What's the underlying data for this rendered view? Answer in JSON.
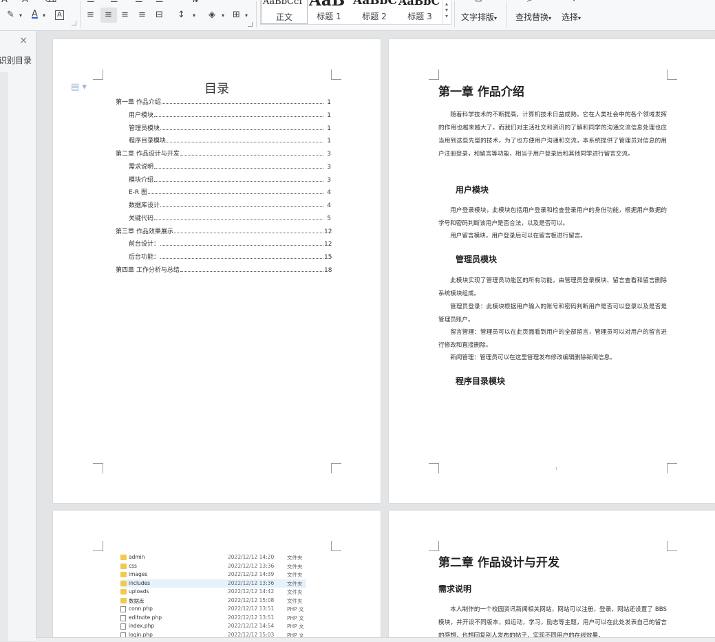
{
  "ribbon": {
    "styles": [
      {
        "preview": "AaBbCcI",
        "label": "正文"
      },
      {
        "preview": "AaB",
        "label": "标题 1"
      },
      {
        "preview": "AaBbC",
        "label": "标题 2"
      },
      {
        "preview": "AaBbC",
        "label": "标题 3"
      }
    ],
    "text_layout_label": "文字排版",
    "find_replace_label": "查找替换",
    "select_label": "选择",
    "dropdown_caret": "▾"
  },
  "nav_pane": {
    "label": "识别目录",
    "close_glyph": "×"
  },
  "toc_page": {
    "title": "目录",
    "entries": [
      {
        "level": 1,
        "text": "第一章  作品介绍",
        "page": "1"
      },
      {
        "level": 2,
        "text": "用户模块",
        "page": "1"
      },
      {
        "level": 2,
        "text": "管理员模块",
        "page": "1"
      },
      {
        "level": 2,
        "text": "程序目录模块",
        "page": "1"
      },
      {
        "level": 1,
        "text": "第二章  作品设计与开发",
        "page": "3"
      },
      {
        "level": 2,
        "text": "需求说明",
        "page": "3"
      },
      {
        "level": 2,
        "text": "模块介绍",
        "page": "3"
      },
      {
        "level": 2,
        "text": "E-R 图",
        "page": "4"
      },
      {
        "level": 2,
        "text": "数据库设计",
        "page": "4"
      },
      {
        "level": 2,
        "text": "关键代码",
        "page": "5"
      },
      {
        "level": 1,
        "text": "第三章  作品效果展示",
        "page": "12"
      },
      {
        "level": 2,
        "text": "前台设计：",
        "page": "12"
      },
      {
        "level": 2,
        "text": "后台功能：",
        "page": "15"
      },
      {
        "level": 1,
        "text": "第四章  工作分析与总结",
        "page": "18"
      }
    ]
  },
  "chapter1_page": {
    "heading": "第一章  作品介绍",
    "intro": "随着科学技术的不断提高，计算机技术日益成熟，它在人类社会中的各个领域发挥的作用也越来越大了。而我们对主活社交和资讯的了解和同学的沟通交流信息处理也应当用到这些先型的技术，为了也方便用户沟通和交流，本系统提供了管理员对信息的用户注册登录，和留言等功能，相当于用户登录后和其他同学进行留言交流。",
    "user_module_heading": "用户模块",
    "user_p1": "用户登录模块，此模块包括用户登录和检查登录用户的身份功能，根据用户数据的学号和密码判断该用户是否合法，以及是否可以。",
    "user_p2": "用户留言模块，用户登录后可以在留言板进行留言。",
    "admin_module_heading": "管理员模块",
    "admin_p1": "此模块实现了管理员功能区的所有功能，由管理员登录模块、留言查看和留言删除系统模块组成。",
    "admin_p2": "管理员登录：此模块根据用户输入的账号和密码判断用户是否可以登录以及是否是管理员账户。",
    "admin_p3": "留言管理：管理员可以在此页面看到用户的全部留言，管理员可以对用户的留言进行修改和直接删除。",
    "admin_p4": "新闻管理：管理员可以在这里管理发布修改编辑删除新闻信息。",
    "program_module_heading": "程序目录模块"
  },
  "files_page": {
    "files": [
      {
        "icon": "folder",
        "name": "admin",
        "date": "2022/12/12 14:20",
        "type": "文件夹"
      },
      {
        "icon": "folder",
        "name": "css",
        "date": "2022/12/12 13:36",
        "type": "文件夹"
      },
      {
        "icon": "folder",
        "name": "images",
        "date": "2022/12/12 14:39",
        "type": "文件夹"
      },
      {
        "icon": "folder",
        "name": "includes",
        "date": "2022/12/12 13:36",
        "type": "文件夹",
        "highlighted": true
      },
      {
        "icon": "folder",
        "name": "uploads",
        "date": "2022/12/12 14:42",
        "type": "文件夹"
      },
      {
        "icon": "folder",
        "name": "数据库",
        "date": "2022/12/12 15:08",
        "type": "文件夹"
      },
      {
        "icon": "php",
        "name": "conn.php",
        "date": "2022/12/12 13:51",
        "type": "PHP 文"
      },
      {
        "icon": "php",
        "name": "editnote.php",
        "date": "2022/12/12 13:51",
        "type": "PHP 文"
      },
      {
        "icon": "php",
        "name": "index.php",
        "date": "2022/12/12 14:54",
        "type": "PHP 文"
      },
      {
        "icon": "php",
        "name": "login.php",
        "date": "2022/12/12 15:03",
        "type": "PHP 文"
      }
    ]
  },
  "chapter2_page": {
    "heading": "第二章  作品设计与开发",
    "subheading": "需求说明",
    "para": "本人制作的一个校园资讯新闻相关网站，网站可以注册，登录，网站还设置了 BBS 模块，并开设不同版本，如运动，学习，励志等主题，用户可以在此处发表自己的留言的感想，也想回复别人发布的帖子，实现不同用户的在线效果，"
  },
  "colors": {
    "workspace_bg": "#e3e4e6",
    "ribbon_bg": "#f7f8fa",
    "page_bg": "#ffffff",
    "folder_icon": "#f2c94c",
    "highlight_row": "#e5f1fb"
  }
}
